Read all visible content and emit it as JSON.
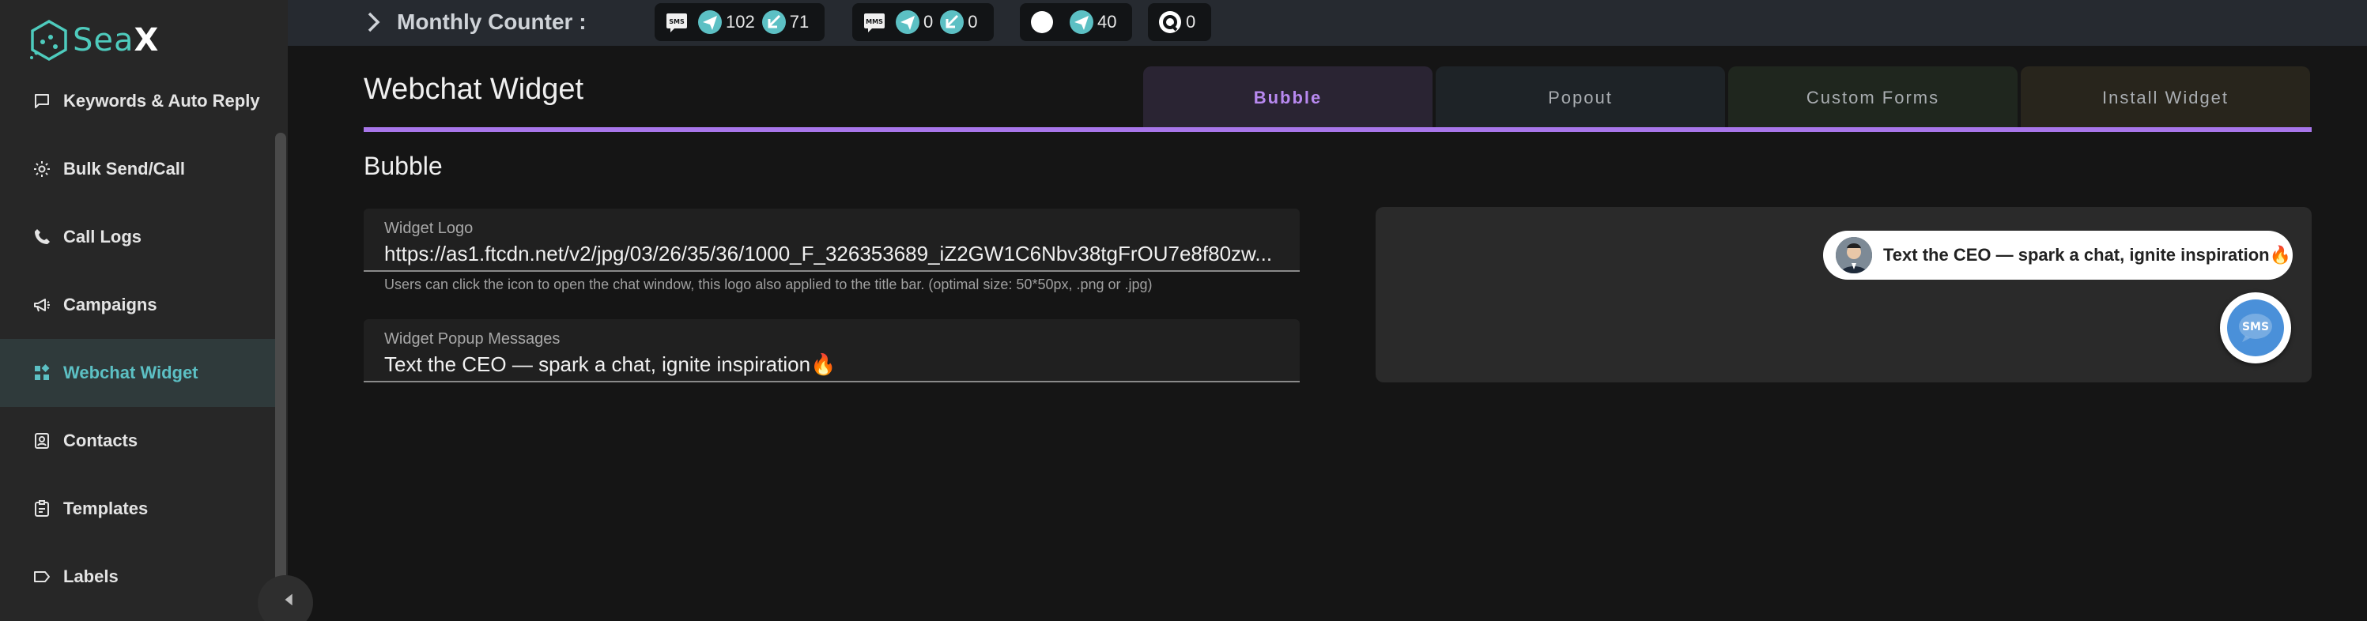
{
  "app": {
    "logo_text": "Sea",
    "logo_x": "X"
  },
  "sidebar": {
    "items": [
      {
        "label": "Keywords & Auto Reply",
        "icon": "message-square-icon"
      },
      {
        "label": "Bulk Send/Call",
        "icon": "gear-icon"
      },
      {
        "label": "Call Logs",
        "icon": "phone-icon"
      },
      {
        "label": "Campaigns",
        "icon": "megaphone-icon"
      },
      {
        "label": "Webchat Widget",
        "icon": "widgets-icon",
        "active": true
      },
      {
        "label": "Contacts",
        "icon": "contact-card-icon"
      },
      {
        "label": "Templates",
        "icon": "template-icon"
      },
      {
        "label": "Labels",
        "icon": "label-icon"
      }
    ]
  },
  "topbar": {
    "counter_title": "Monthly Counter :",
    "groups": [
      {
        "type": "sms",
        "icon": "sms-icon",
        "sent": "102",
        "received": "71"
      },
      {
        "type": "mms",
        "icon": "mms-icon",
        "sent": "0",
        "received": "0"
      },
      {
        "type": "whatsapp",
        "icon": "circle-icon",
        "sent": "40"
      },
      {
        "type": "chat",
        "icon": "chat-bubble-icon",
        "count": "0"
      }
    ]
  },
  "main": {
    "title": "Webchat Widget",
    "tabs": [
      {
        "label": "Bubble",
        "active": true
      },
      {
        "label": "Popout"
      },
      {
        "label": "Custom Forms"
      },
      {
        "label": "Install Widget"
      }
    ],
    "section_title": "Bubble",
    "fields": {
      "logo": {
        "label": "Widget Logo",
        "value": "https://as1.ftcdn.net/v2/jpg/03/26/35/36/1000_F_326353689_iZ2GW1C6Nbv38tgFrOU7e8f80zw...",
        "helper": "Users can click the icon to open the chat window, this logo also applied to the title bar. (optimal size: 50*50px, .png or .jpg)"
      },
      "popup": {
        "label": "Widget Popup Messages",
        "value": "Text the CEO — spark a chat, ignite inspiration🔥"
      }
    },
    "preview": {
      "bubble_text": "Text the CEO — spark a chat, ignite inspiration🔥",
      "button_label": "SMS"
    }
  },
  "colors": {
    "accent": "#a876ea",
    "brand": "#4ecbbd",
    "active_nav": "#5cc0c4",
    "sms_blue": "#4a90d9"
  }
}
